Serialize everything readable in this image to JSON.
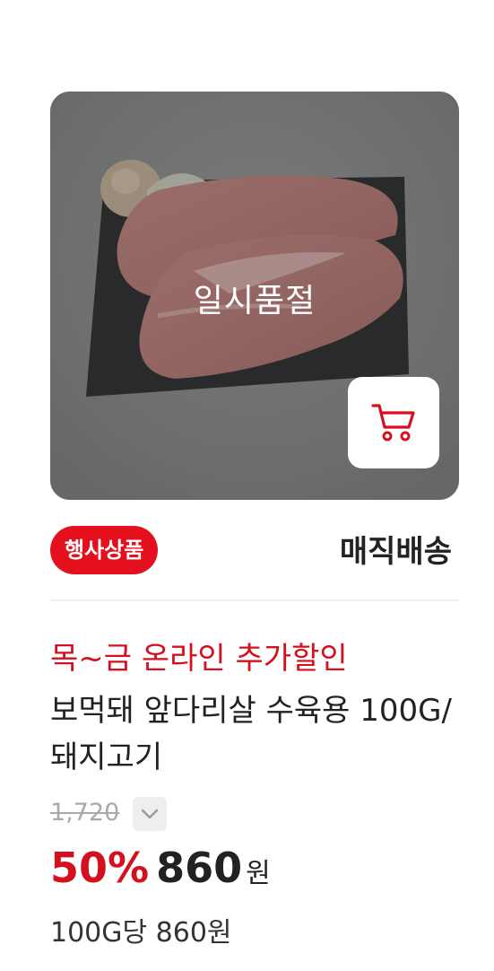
{
  "product": {
    "soldout_label": "일시품절",
    "cart_icon": "shopping-cart-icon",
    "event_badge": "행사상품",
    "delivery_type": "매직배송",
    "promo": "목~금 온라인 추가할인",
    "name": "보먹돼 앞다리살 수육용 100G/돼지고기",
    "original_price": "1,720",
    "expand_icon": "chevron-down-icon",
    "discount_rate": "50%",
    "sale_price": "860",
    "currency": "원",
    "unit_price": "100G당 860원"
  },
  "colors": {
    "accent": "#e5101d",
    "promo_red": "#d5101e",
    "text": "#222222",
    "muted": "#aaaaaa"
  }
}
